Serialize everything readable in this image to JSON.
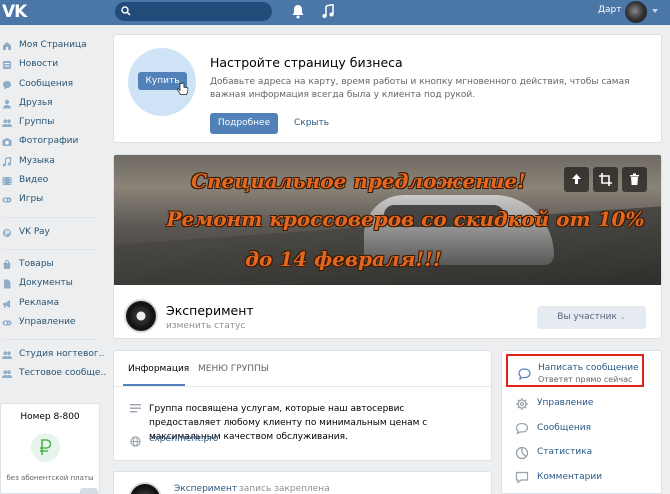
{
  "header": {
    "logo": "VK",
    "user_name": "Дарт",
    "icons": [
      "search-icon",
      "bell-icon",
      "music-icon",
      "chevron-down-icon"
    ],
    "accent": "#4a76a8"
  },
  "left_menu": {
    "items": [
      {
        "label": "Моя Страница",
        "icon": "home-icon"
      },
      {
        "label": "Новости",
        "icon": "news-icon"
      },
      {
        "label": "Сообщения",
        "icon": "chat-icon"
      },
      {
        "label": "Друзья",
        "icon": "user-icon"
      },
      {
        "label": "Группы",
        "icon": "group-icon"
      },
      {
        "label": "Фотографии",
        "icon": "camera-icon"
      },
      {
        "label": "Музыка",
        "icon": "music-icon"
      },
      {
        "label": "Видео",
        "icon": "video-icon"
      },
      {
        "label": "Игры",
        "icon": "gamepad-icon"
      }
    ],
    "pay": {
      "label": "VK Pay",
      "icon": "pay-icon"
    },
    "items2": [
      {
        "label": "Товары",
        "icon": "shop-icon"
      },
      {
        "label": "Документы",
        "icon": "document-icon"
      },
      {
        "label": "Реклама",
        "icon": "megaphone-icon"
      },
      {
        "label": "Управление",
        "icon": "gamepad-icon"
      }
    ],
    "items3": [
      {
        "label": "Студия ногтевог..",
        "icon": "group-icon"
      },
      {
        "label": "Тестовое сообще..",
        "icon": "group-icon"
      }
    ],
    "ad": {
      "title": "Номер 8-800",
      "subtitle": "без абонентской платы"
    }
  },
  "business": {
    "buy_label": "Купить",
    "title": "Настройте страницу бизнеса",
    "text": "Добавьте адреса на карту, время работы и кнопку мгновенного действия, чтобы самая важная информация всегда была у клиента под рукой.",
    "more_label": "Подробнее",
    "hide_label": "Скрыть"
  },
  "group": {
    "cover_line1": "Специальное предложение!",
    "cover_line2": "Ремонт кроссоверов со скидкой от 10%",
    "cover_line3": "до 14 февраля!!!",
    "name": "Эксперимент",
    "status_placeholder": "изменить статус",
    "member_button": "Вы участник",
    "cover_icons": [
      "upload-icon",
      "crop-icon",
      "trash-icon"
    ]
  },
  "info": {
    "tabs": [
      "Информация",
      "МЕНЮ ГРУППЫ"
    ],
    "description": "Группа посвящена услугам, которые наш автосервис предоставляет любому клиенту по минимальным ценам с максимальным качеством обслуживания.",
    "site": "experiment.pro"
  },
  "post": {
    "author": "Эксперимент",
    "note": "запись закреплена"
  },
  "right_panel": {
    "message_title": "Написать сообщение",
    "message_sub": "Ответят прямо сейчас",
    "highlight_color": "#e2231a",
    "items": [
      {
        "label": "Управление",
        "icon": "gear-icon"
      },
      {
        "label": "Сообщения",
        "icon": "chat-icon"
      },
      {
        "label": "Статистика",
        "icon": "stats-icon"
      },
      {
        "label": "Комментарии",
        "icon": "comment-icon"
      }
    ]
  }
}
